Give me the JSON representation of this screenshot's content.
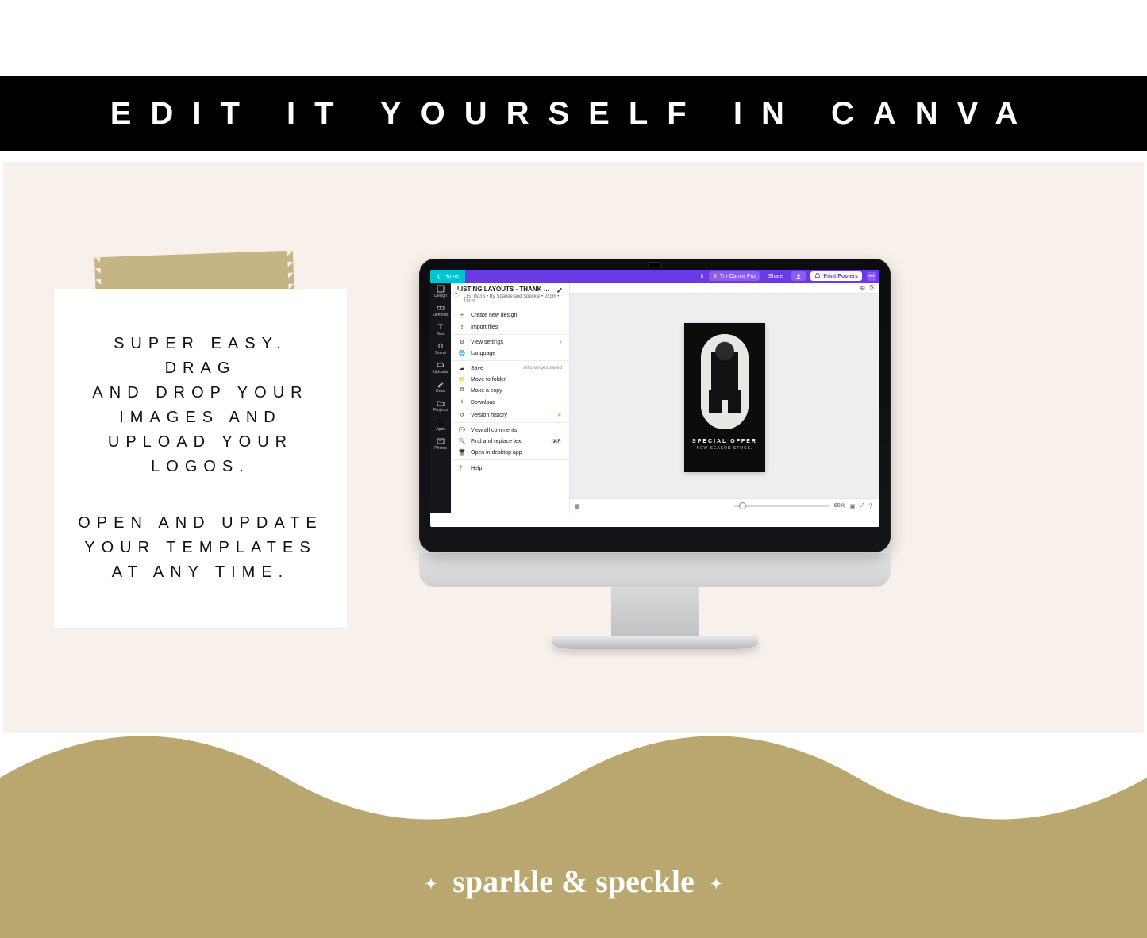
{
  "banner": {
    "title": "EDIT IT YOURSELF IN CANVA"
  },
  "card": {
    "p1": "SUPER EASY. DRAG\nAND DROP YOUR\nIMAGES AND\nUPLOAD YOUR\nLOGOS.",
    "p2": "OPEN AND UPDATE\nYOUR TEMPLATES\nAT ANY TIME."
  },
  "footer": {
    "brand": "sparkle & speckle"
  },
  "canva": {
    "home_label": "Home",
    "top": {
      "try_pro": "Try Canva Pro",
      "share": "Share",
      "print": "Print Posters",
      "more": "•••"
    },
    "rail": [
      {
        "label": "Design"
      },
      {
        "label": "Elements"
      },
      {
        "label": "Text"
      },
      {
        "label": "Brand"
      },
      {
        "label": "Uploads"
      },
      {
        "label": "Draw"
      },
      {
        "label": "Projects"
      },
      {
        "label": "Apps"
      },
      {
        "label": "Photos"
      }
    ],
    "doc": {
      "title": "LISTING LAYOUTS - THANK …",
      "subtitle": "LISTINGS • By Sparkle and Speckle • 22cm • 18cm"
    },
    "menu": {
      "create": "Create new design",
      "import": "Import files",
      "view": "View settings",
      "language": "Language",
      "save": "Save",
      "save_tag": "All changes saved",
      "move": "Move to folder",
      "copy": "Make a copy",
      "download": "Download",
      "version": "Version history",
      "comments": "View all comments",
      "find": "Find and replace text",
      "find_kbd": "⌘F",
      "desktop": "Open in desktop app",
      "help": "Help"
    },
    "artboard": {
      "headline": "SPECIAL OFFER",
      "subline": "NEW SEASON STOCK."
    },
    "footer": {
      "zoom": "60%"
    }
  }
}
